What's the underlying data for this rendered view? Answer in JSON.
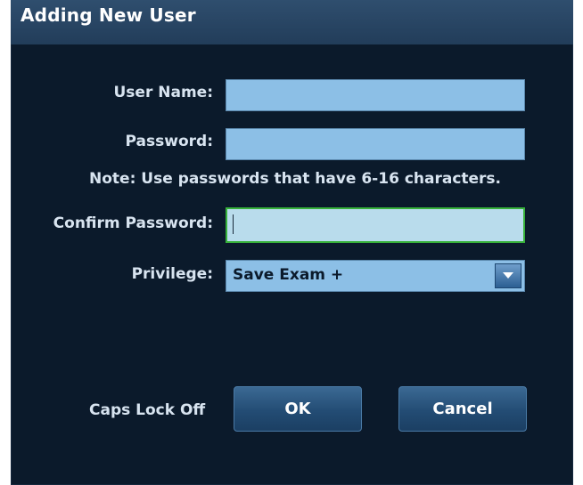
{
  "dialog": {
    "title": "Adding New User"
  },
  "form": {
    "user_name_label": "User Name:",
    "user_name_value": "",
    "password_label": "Password:",
    "password_value": "",
    "note": "Note: Use passwords that have 6-16 characters.",
    "confirm_password_label": "Confirm Password:",
    "confirm_password_value": "",
    "privilege_label": "Privilege:",
    "privilege_selected": "Save Exam +"
  },
  "footer": {
    "caps_lock_status": "Caps Lock Off",
    "ok_label": "OK",
    "cancel_label": "Cancel"
  },
  "colors": {
    "background": "#0b1a2b",
    "title_bar": "#223d5a",
    "field_fill": "#8cbfe6",
    "focused_field_fill": "#b9dcec",
    "focus_border": "#37b13a",
    "button_fill": "#234c74"
  },
  "icons": {
    "dropdown": "chevron-down-icon",
    "caret": "text-cursor-icon"
  }
}
